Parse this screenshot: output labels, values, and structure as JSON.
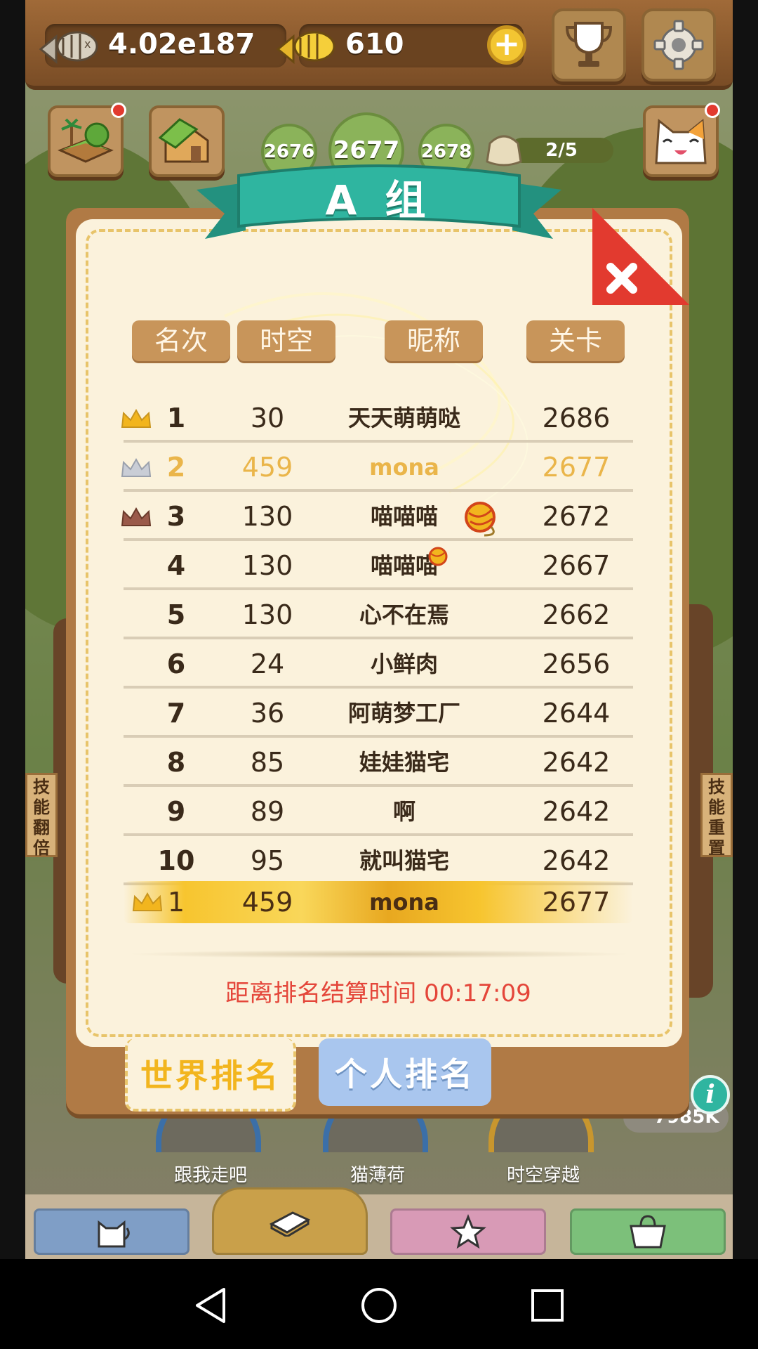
{
  "resources": {
    "fish_bones": "4.02e187",
    "gold_fish": "610"
  },
  "levels": {
    "prev": "2676",
    "current": "2677",
    "next": "2678",
    "progress": "2/5"
  },
  "side_labels": {
    "left": [
      "技",
      "能",
      "翻",
      "倍"
    ],
    "right": [
      "技",
      "能",
      "重",
      "置"
    ]
  },
  "modal": {
    "title": "A 组",
    "headers": {
      "rank": "名次",
      "time": "时空",
      "name": "昵称",
      "stage": "关卡"
    },
    "rows": [
      {
        "rank": "1",
        "time": "30",
        "name": "天天萌萌哒",
        "stage": "2686",
        "crown": "gold"
      },
      {
        "rank": "2",
        "time": "459",
        "name": "mona",
        "stage": "2677",
        "crown": "silver"
      },
      {
        "rank": "3",
        "time": "130",
        "name": "喵喵喵",
        "stage": "2672",
        "crown": "bronze"
      },
      {
        "rank": "4",
        "time": "130",
        "name": "喵喵喵",
        "stage": "2667"
      },
      {
        "rank": "5",
        "time": "130",
        "name": "心不在焉",
        "stage": "2662"
      },
      {
        "rank": "6",
        "time": "24",
        "name": "小鲜肉",
        "stage": "2656"
      },
      {
        "rank": "7",
        "time": "36",
        "name": "阿萌梦工厂",
        "stage": "2644"
      },
      {
        "rank": "8",
        "time": "85",
        "name": "娃娃猫宅",
        "stage": "2642"
      },
      {
        "rank": "9",
        "time": "89",
        "name": "啊",
        "stage": "2642"
      },
      {
        "rank": "10",
        "time": "95",
        "name": "就叫猫宅",
        "stage": "2642"
      }
    ],
    "my_row": {
      "rank": "1",
      "time": "459",
      "name": "mona",
      "stage": "2677"
    },
    "countdown": "距离排名结算时间 00:17:09",
    "tabs": {
      "world": "世界排名",
      "personal": "个人排名"
    }
  },
  "bottom": {
    "captions": [
      "跟我走吧",
      "猫薄荷",
      "时空穿越"
    ],
    "coin_value": "7985K"
  },
  "colors": {
    "ribbon": "#2fb5a0",
    "close": "#e23a2f",
    "countdown": "#e4463a",
    "gold": "#f7c52f"
  }
}
